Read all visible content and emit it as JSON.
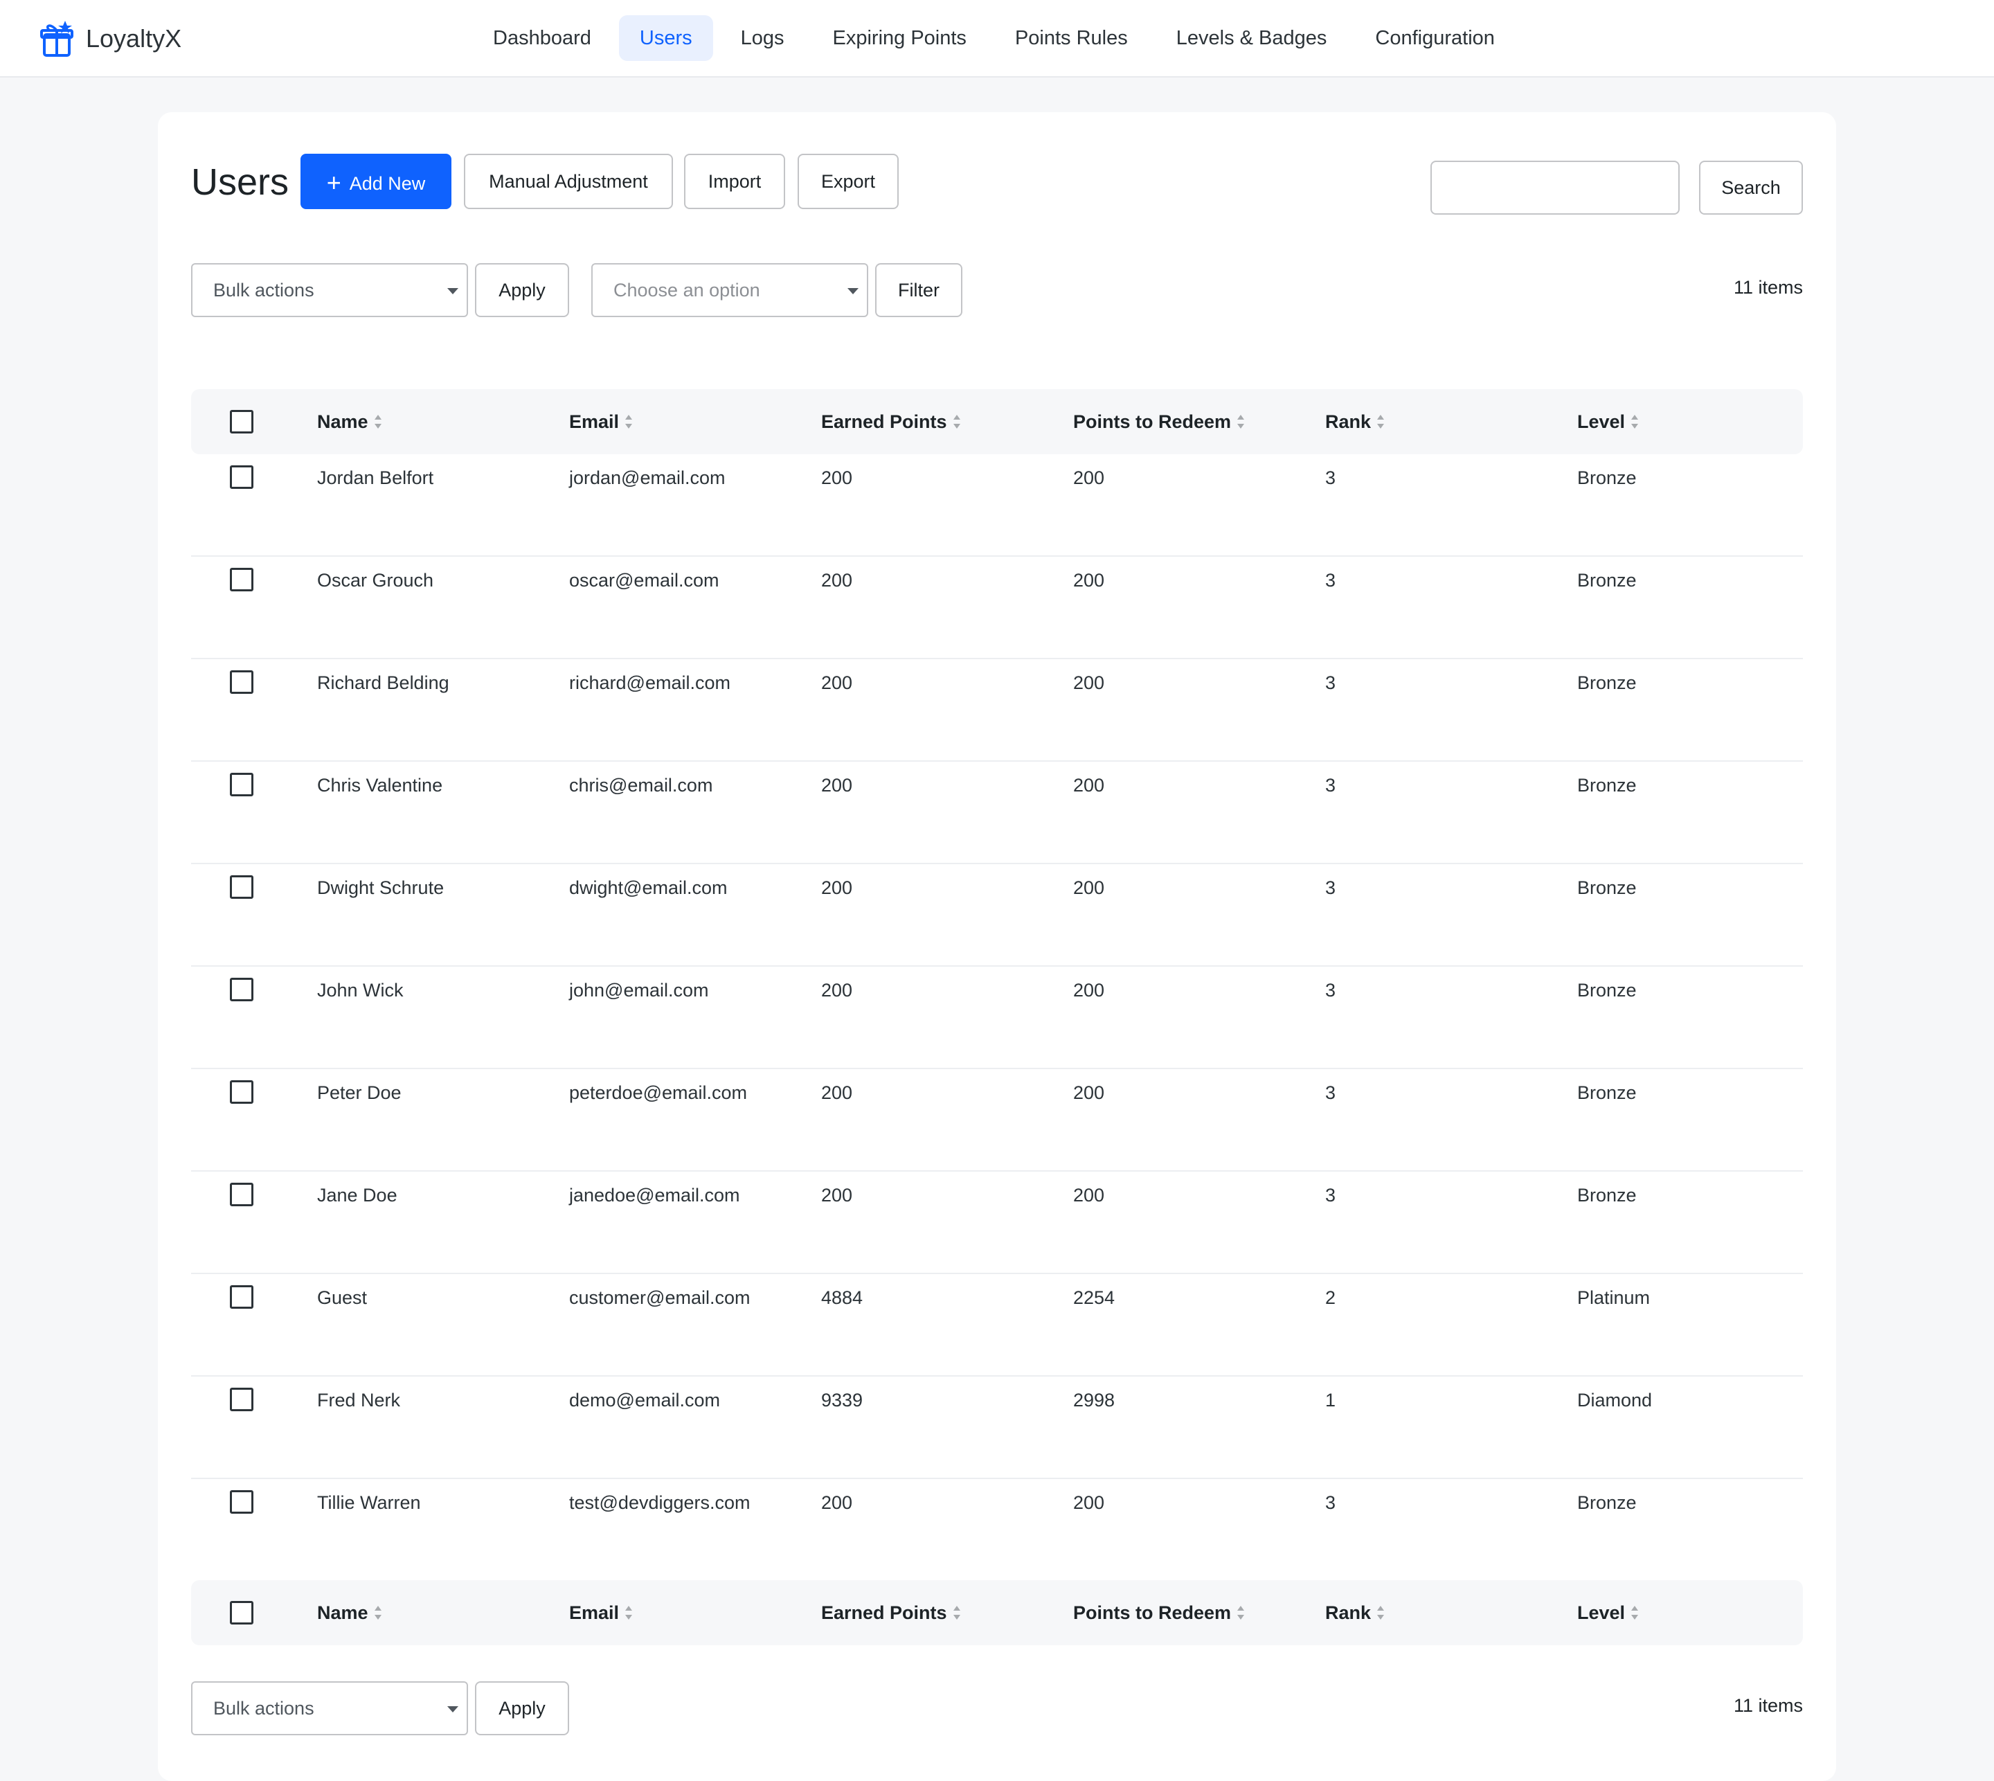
{
  "brand": {
    "name": "LoyaltyX"
  },
  "nav": [
    {
      "label": "Dashboard"
    },
    {
      "label": "Users"
    },
    {
      "label": "Logs"
    },
    {
      "label": "Expiring Points"
    },
    {
      "label": "Points Rules"
    },
    {
      "label": "Levels & Badges"
    },
    {
      "label": "Configuration"
    }
  ],
  "nav_active": "Users",
  "page": {
    "title": "Users",
    "add_new": "Add New",
    "manual_adjustment": "Manual Adjustment",
    "import": "Import",
    "export": "Export",
    "search_value": "",
    "search_button": "Search"
  },
  "top_controls": {
    "bulk_actions": "Bulk actions",
    "apply": "Apply",
    "filter_placeholder": "Choose an option",
    "filter": "Filter",
    "count": "11 items"
  },
  "bottom_controls": {
    "bulk_actions": "Bulk actions",
    "apply": "Apply",
    "count": "11 items"
  },
  "columns": [
    "Name",
    "Email",
    "Earned Points",
    "Points to Redeem",
    "Rank",
    "Level"
  ],
  "rows": [
    [
      "Jordan Belfort",
      "jordan@email.com",
      "200",
      "200",
      "3",
      "Bronze"
    ],
    [
      "Oscar Grouch",
      "oscar@email.com",
      "200",
      "200",
      "3",
      "Bronze"
    ],
    [
      "Richard Belding",
      "richard@email.com",
      "200",
      "200",
      "3",
      "Bronze"
    ],
    [
      "Chris Valentine",
      "chris@email.com",
      "200",
      "200",
      "3",
      "Bronze"
    ],
    [
      "Dwight Schrute",
      "dwight@email.com",
      "200",
      "200",
      "3",
      "Bronze"
    ],
    [
      "John Wick",
      "john@email.com",
      "200",
      "200",
      "3",
      "Bronze"
    ],
    [
      "Peter Doe",
      "peterdoe@email.com",
      "200",
      "200",
      "3",
      "Bronze"
    ],
    [
      "Jane Doe",
      "janedoe@email.com",
      "200",
      "200",
      "3",
      "Bronze"
    ],
    [
      "Guest",
      "customer@email.com",
      "4884",
      "2254",
      "2",
      "Platinum"
    ],
    [
      "Fred Nerk",
      "demo@email.com",
      "9339",
      "2998",
      "1",
      "Diamond"
    ],
    [
      "Tillie Warren",
      "test@devdiggers.com",
      "200",
      "200",
      "3",
      "Bronze"
    ]
  ],
  "colors": {
    "accent": "#0f62fe",
    "nav_active_bg": "#e9f0fe",
    "header_bg": "#f6f7f9"
  },
  "icons": {
    "brand": "gift-icon",
    "sort": "sort-arrows-icon",
    "plus": "plus-icon"
  }
}
